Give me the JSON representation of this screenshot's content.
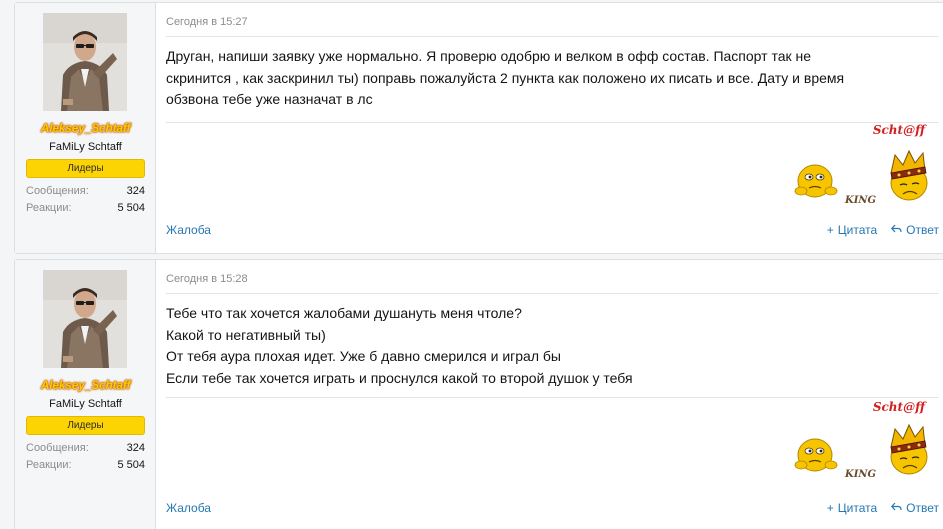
{
  "posts": [
    {
      "author": {
        "name": "Aleksey_Schtaff",
        "title": "FaMiLy Schtaff",
        "banner": "Лидеры",
        "stats": [
          {
            "label": "Сообщения:",
            "value": "324"
          },
          {
            "label": "Реакции:",
            "value": "5 504"
          }
        ]
      },
      "date": "Сегодня в 15:27",
      "body": [
        "Друган, напиши заявку уже нормально. Я проверю одобрю и велком в офф состав. Паспорт так не",
        "скринится , как заскринил ты) поправь пожалуйста 2 пункта как положено их писать и все. Дату и время",
        "обзвона тебе уже назначат в лс"
      ],
      "signature": {
        "text": "Scht@ff",
        "smiley_caption": "KING"
      },
      "footer": {
        "report": "Жалоба",
        "quote": "Цитата",
        "reply": "Ответ"
      }
    },
    {
      "author": {
        "name": "Aleksey_Schtaff",
        "title": "FaMiLy Schtaff",
        "banner": "Лидеры",
        "stats": [
          {
            "label": "Сообщения:",
            "value": "324"
          },
          {
            "label": "Реакции:",
            "value": "5 504"
          }
        ]
      },
      "date": "Сегодня в 15:28",
      "body": [
        "Тебе что так хочется жалобами душануть меня чтоле?",
        "Какой то негативный ты)",
        "От тебя аура плохая идет. Уже б давно смерился и играл бы",
        "Если тебе так хочется играть и проснулся какой то второй душок у тебя"
      ],
      "signature": {
        "text": "Scht@ff",
        "smiley_caption": "KING"
      },
      "footer": {
        "report": "Жалоба",
        "quote": "Цитата",
        "reply": "Ответ"
      }
    }
  ],
  "icons": {
    "quote": "plus-icon",
    "reply": "reply-arrow-icon"
  },
  "colors": {
    "link": "#2577b1",
    "username": "#ffcc00",
    "banner": "#fcd303",
    "signature": "#d21f1f"
  }
}
